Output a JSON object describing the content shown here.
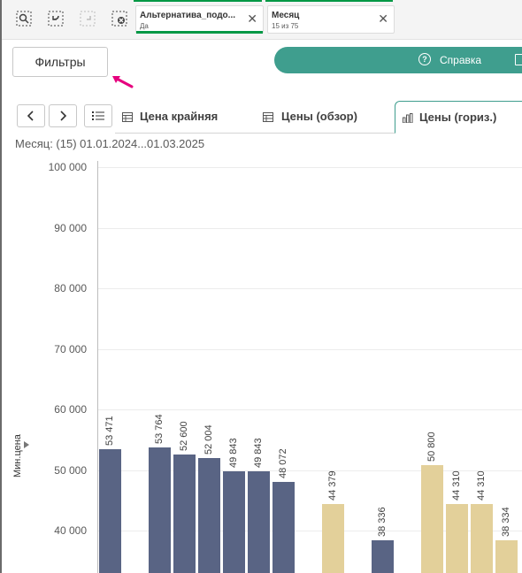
{
  "selection_bar": {
    "chips": [
      {
        "title": "Альтернатива_подо...",
        "value": "Да"
      },
      {
        "title": "Месяц",
        "value": "15 из 75"
      }
    ]
  },
  "toolbar": {
    "filters_label": "Фильтры",
    "help_label": "Справка"
  },
  "tabs": [
    {
      "label": "Цена крайняя"
    },
    {
      "label": "Цены (обзор)"
    },
    {
      "label": "Цены (гориз.)"
    }
  ],
  "month_filter_text": "Месяц: (15) 01.01.2024...01.03.2025",
  "colors": {
    "dark_bar": "#596484",
    "light_bar": "#e3d09a",
    "accent": "#3f9e8e",
    "selection": "#009845"
  },
  "chart_data": {
    "type": "bar",
    "ylabel": "Мин.цена",
    "ylim": [
      40000,
      100000
    ],
    "ytick_labels": [
      "100 000",
      "90 000",
      "80 000",
      "70 000",
      "60 000",
      "50 000",
      "40 000"
    ],
    "bars": [
      {
        "value": 53471,
        "label": "53 471",
        "color": "dark"
      },
      {
        "value": 53764,
        "label": "53 764",
        "color": "dark"
      },
      {
        "value": 52600,
        "label": "52 600",
        "color": "dark"
      },
      {
        "value": 52004,
        "label": "52 004",
        "color": "dark"
      },
      {
        "value": 49843,
        "label": "49 843",
        "color": "dark"
      },
      {
        "value": 49843,
        "label": "49 843",
        "color": "dark"
      },
      {
        "value": 48072,
        "label": "48 072",
        "color": "dark"
      },
      {
        "value": 44379,
        "label": "44 379",
        "color": "light"
      },
      {
        "value": 38336,
        "label": "38 336",
        "color": "dark"
      },
      {
        "value": 50800,
        "label": "50 800",
        "color": "light"
      },
      {
        "value": 44310,
        "label": "44 310",
        "color": "light"
      },
      {
        "value": 44310,
        "label": "44 310",
        "color": "light"
      },
      {
        "value": 38334,
        "label": "38 334",
        "color": "light"
      }
    ]
  }
}
